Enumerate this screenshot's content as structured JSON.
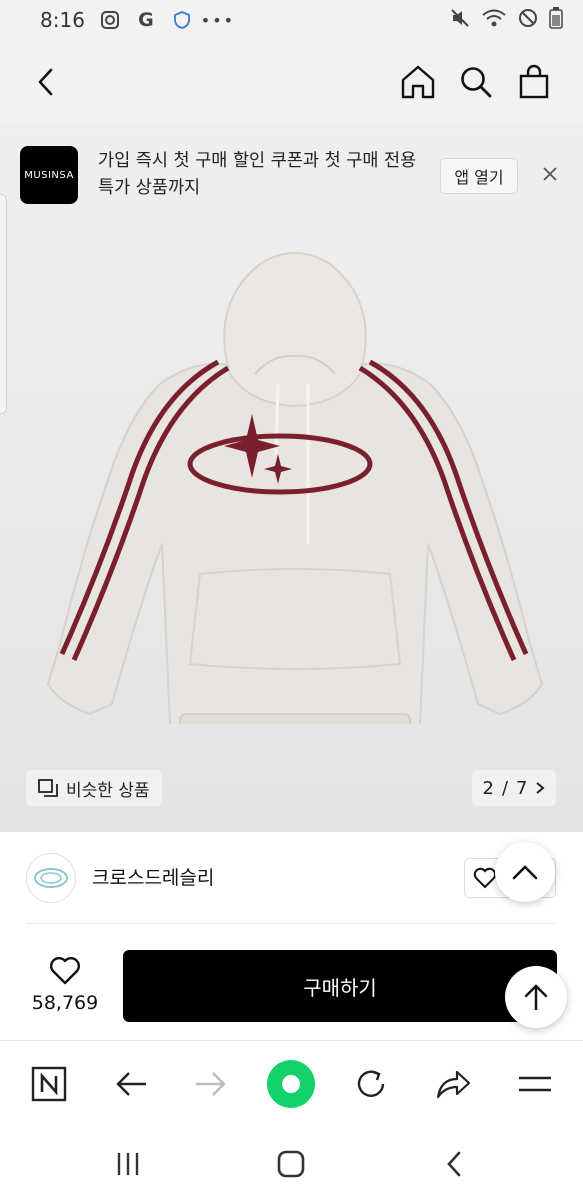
{
  "status_bar": {
    "time": "8:16",
    "left_icons": [
      "instagram-icon",
      "google-icon",
      "shield-icon",
      "more-dots-icon"
    ],
    "right_icons": [
      "mute-icon",
      "wifi-icon",
      "do-not-disturb-icon",
      "battery-icon"
    ]
  },
  "banner": {
    "logo_text": "MUSINSA",
    "message": "가입 즉시 첫 구매 할인 쿠폰과 첫 구매 전용 특가 상품까지",
    "open_app_label": "앱 열기"
  },
  "gallery": {
    "similar_label": "비슷한 상품",
    "page_current": "2",
    "page_separator": "/",
    "page_total": "7",
    "hoodie_color": "#e8e5e1",
    "stripe_color": "#7a1f2e"
  },
  "brand": {
    "name": "크로스드레슬리"
  },
  "purchase": {
    "like_count": "58,769",
    "buy_label": "구매하기"
  },
  "colors": {
    "accent_green": "#12d26a",
    "buy_button": "#000000"
  }
}
